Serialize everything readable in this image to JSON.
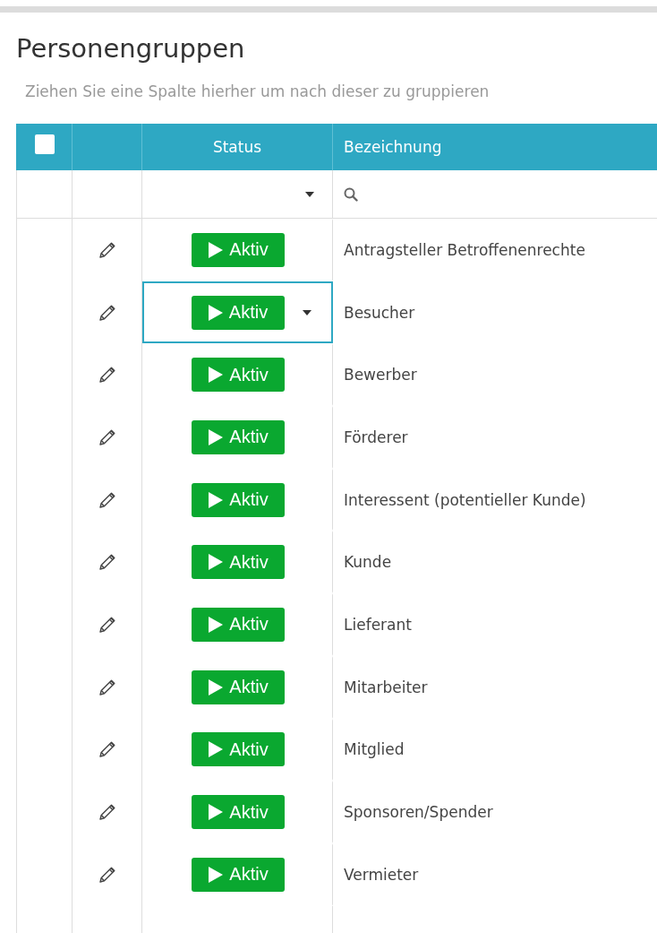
{
  "title": "Personengruppen",
  "group_hint": "Ziehen Sie eine Spalte hierher um nach dieser zu gruppieren",
  "table": {
    "select_all": {
      "checked": false
    },
    "columns": [
      "Status",
      "Bezeichnung"
    ],
    "rows": [
      {
        "status": "Aktiv",
        "name": "Antragsteller Betroffenenrechte",
        "focused": false
      },
      {
        "status": "Aktiv",
        "name": "Besucher",
        "focused": true
      },
      {
        "status": "Aktiv",
        "name": "Bewerber",
        "focused": false
      },
      {
        "status": "Aktiv",
        "name": "Förderer",
        "focused": false
      },
      {
        "status": "Aktiv",
        "name": "Interessent (potentieller Kunde)",
        "focused": false
      },
      {
        "status": "Aktiv",
        "name": "Kunde",
        "focused": false
      },
      {
        "status": "Aktiv",
        "name": "Lieferant",
        "focused": false
      },
      {
        "status": "Aktiv",
        "name": "Mitarbeiter",
        "focused": false
      },
      {
        "status": "Aktiv",
        "name": "Mitglied",
        "focused": false
      },
      {
        "status": "Aktiv",
        "name": "Sponsoren/Spender",
        "focused": false
      },
      {
        "status": "Aktiv",
        "name": "Vermieter",
        "focused": false
      }
    ]
  }
}
